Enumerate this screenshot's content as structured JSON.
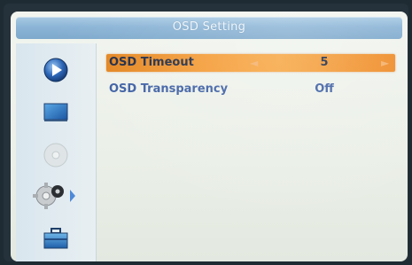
{
  "window": {
    "title": "OSD Setting"
  },
  "sidebar": {
    "items": [
      {
        "icon": "play-icon"
      },
      {
        "icon": "tv-screen-icon"
      },
      {
        "icon": "disc-icon"
      },
      {
        "icon": "settings-gear-icon",
        "selected": true
      },
      {
        "icon": "toolbox-icon"
      }
    ]
  },
  "settings": {
    "rows": [
      {
        "label": "OSD Timeout",
        "value": "5",
        "selected": true
      },
      {
        "label": "OSD Transparency",
        "value": "Off",
        "selected": false
      }
    ]
  },
  "colors": {
    "highlight": "#f59b35",
    "label_text": "#3d5fa3",
    "title_bar": "#8bb4d6"
  }
}
